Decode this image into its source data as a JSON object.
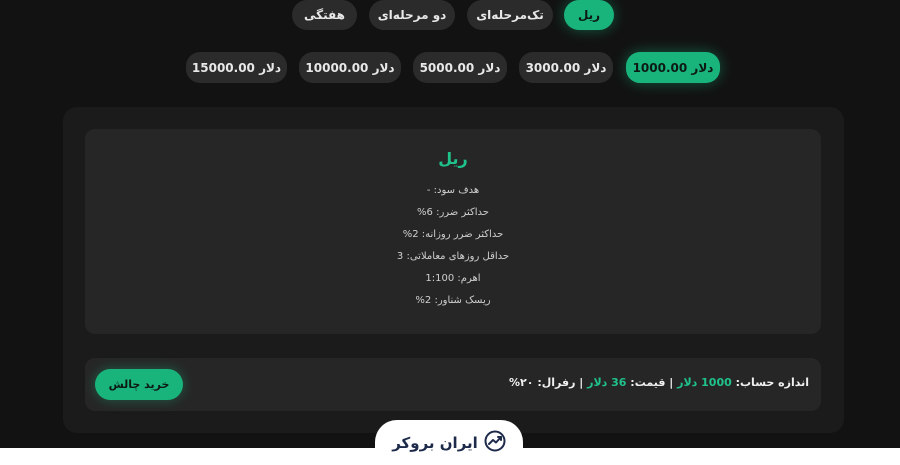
{
  "plan_tabs": [
    {
      "label": "ریل",
      "active": true
    },
    {
      "label": "تک‌مرحله‌ای",
      "active": false
    },
    {
      "label": "دو مرحله‌ای",
      "active": false
    },
    {
      "label": "هفتگی",
      "active": false
    }
  ],
  "amounts": [
    {
      "label": "1000.00 دلار",
      "active": true
    },
    {
      "label": "3000.00 دلار",
      "active": false
    },
    {
      "label": "5000.00 دلار",
      "active": false
    },
    {
      "label": "10000.00 دلار",
      "active": false
    },
    {
      "label": "15000.00 دلار",
      "active": false
    }
  ],
  "details": {
    "title": "ریل",
    "rules": [
      "هدف سود: -",
      "حداکثر ضرر: 6%",
      "حداکثر ضرر روزانه: 2%",
      "حداقل روزهای معاملاتی: 3",
      "اهرم: 1:100",
      "ریسک شناور: 2%"
    ]
  },
  "summary": {
    "account_size_label": "اندازه حساب:",
    "account_size_value": "1000 دلار",
    "separator": "|",
    "price_label": "قیمت:",
    "price_value": "36 دلار",
    "refund_label": "رفرال:",
    "refund_value": "۲۰%"
  },
  "buy_button": "خرید چالش",
  "logo": {
    "text": "ایران بروکر",
    "icon": "trend-chart-icon"
  },
  "colors": {
    "accent": "#19b47c",
    "background": "#121212",
    "card": "#262626"
  }
}
